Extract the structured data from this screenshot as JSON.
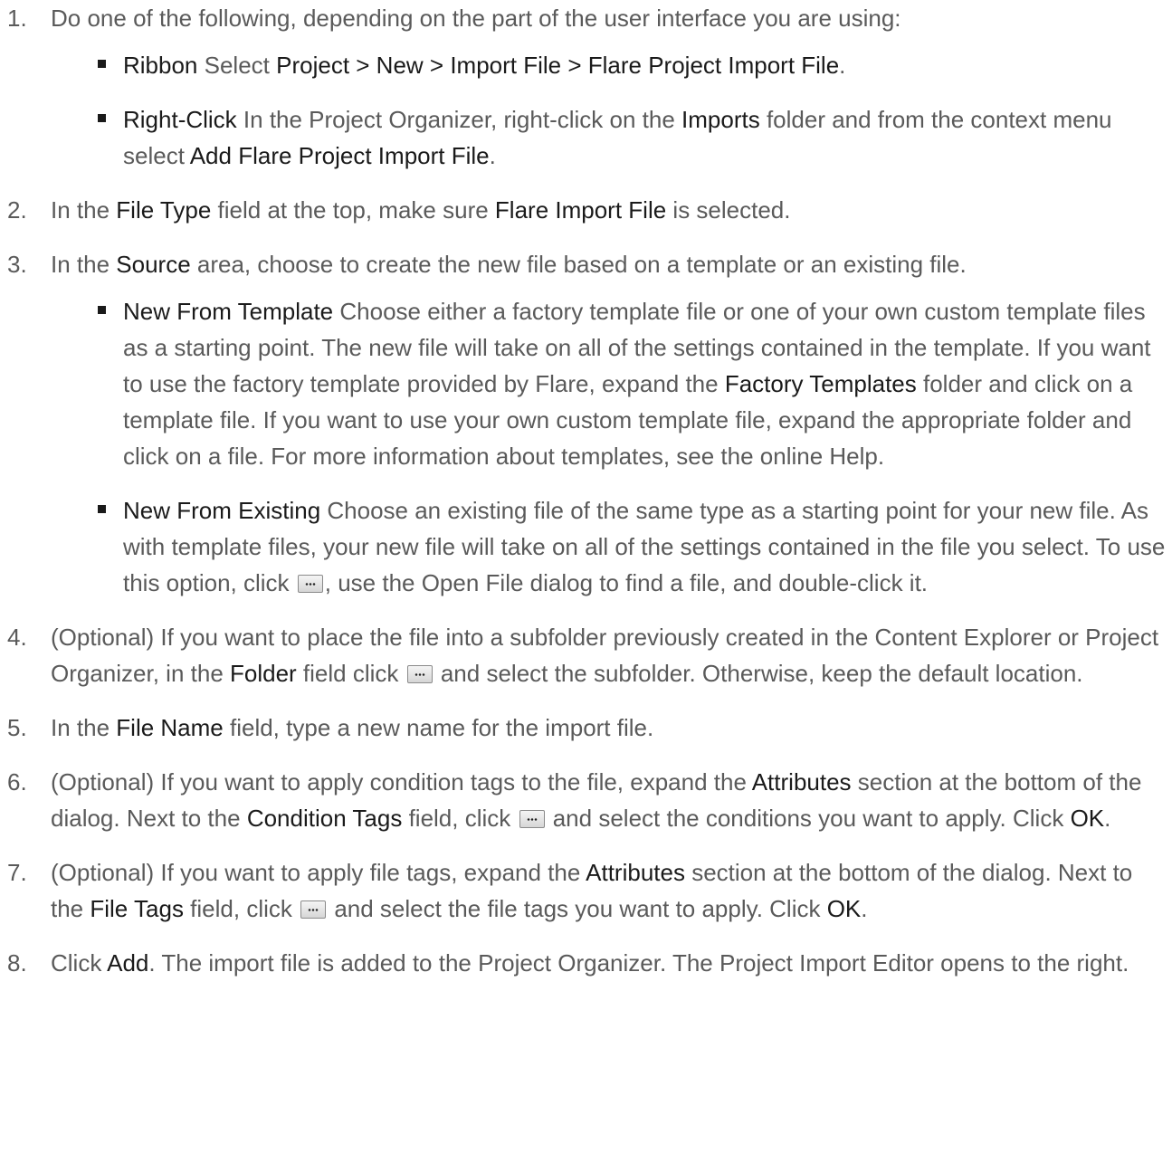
{
  "steps": [
    {
      "num": "1.",
      "parts": [
        "Do one of the following, depending on the part of the user interface you are using:"
      ],
      "sub": [
        {
          "label": "Ribbon",
          "parts": [
            " Select ",
            "Project > New > Import File > Flare Project Import File",
            "."
          ]
        },
        {
          "label": "Right-Click",
          "parts": [
            " In the Project Organizer, right-click on the ",
            "Imports",
            " folder and from the context menu select ",
            "Add Flare Project Import File",
            "."
          ]
        }
      ]
    },
    {
      "num": "2.",
      "parts": [
        "In the ",
        "File Type",
        " field at the top, make sure ",
        "Flare Import File",
        " is selected."
      ]
    },
    {
      "num": "3.",
      "parts": [
        "In the ",
        "Source",
        " area, choose to create the new file based on a template or an existing file."
      ],
      "sub": [
        {
          "label": "New From Template",
          "parts": [
            " Choose either a factory template file or one of your own custom template files as a starting point. The new file will take on all of the settings contained in the template. If you want to use the factory template provided by Flare, expand the ",
            "Factory Templates",
            " folder and click on a template file. If you want to use your own custom template file, expand the appropriate folder and click on a file. For more information about templates, see the online Help."
          ]
        },
        {
          "label": "New From Existing",
          "parts": [
            " Choose an existing file of the same type as a starting point for your new file. As with template files, your new file will take on all of the settings contained in the file you select. To use this option, click ",
            ", use the Open File dialog to find a file, and double-click it."
          ]
        }
      ]
    },
    {
      "num": "4.",
      "parts": [
        "(Optional) If you want to place the file into a subfolder previously created in the Content Explorer or Project Organizer, in the ",
        "Folder",
        " field click ",
        " and select the subfolder. Otherwise, keep the default location."
      ]
    },
    {
      "num": "5.",
      "parts": [
        "In the ",
        "File Name",
        " field, type a new name for the import file."
      ]
    },
    {
      "num": "6.",
      "parts": [
        "(Optional) If you want to apply condition tags to the file, expand the ",
        "Attributes",
        " section at the bottom of the dialog. Next to the ",
        "Condition Tags",
        " field, click ",
        " and select the conditions you want to apply. Click ",
        "OK",
        "."
      ]
    },
    {
      "num": "7.",
      "parts": [
        "(Optional) If you want to apply file tags, expand the ",
        "Attributes",
        " section at the bottom of the dialog. Next to the ",
        "File Tags",
        " field, click ",
        " and select the file tags you want to apply. Click ",
        "OK",
        "."
      ]
    },
    {
      "num": "8.",
      "parts": [
        "Click ",
        "Add",
        ". The import file is added to the Project Organizer. The Project Import Editor opens to the right."
      ]
    }
  ],
  "icons": {
    "browse": "ellipsis-button-icon"
  }
}
